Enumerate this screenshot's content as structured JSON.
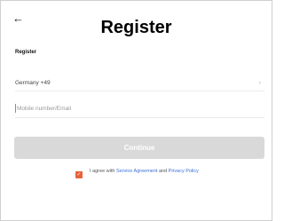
{
  "header": {
    "back_icon": "arrow-left-icon",
    "title": "Register"
  },
  "form": {
    "section_title": "Register",
    "country_label": "Germany +49",
    "country_chevron_icon": "chevron-right-icon",
    "account_placeholder": "Mobile number/Email",
    "account_value": "",
    "continue_label": "Continue"
  },
  "agreement": {
    "checked": true,
    "checkbox_icon": "check-icon",
    "prefix": "I agree with ",
    "service_link": "Service Agreement",
    "middle": " and ",
    "privacy_link": "Privacy Policy"
  },
  "colors": {
    "accent": "#e8613a",
    "link": "#3b6fd6",
    "button_disabled": "#d9d9d9"
  }
}
